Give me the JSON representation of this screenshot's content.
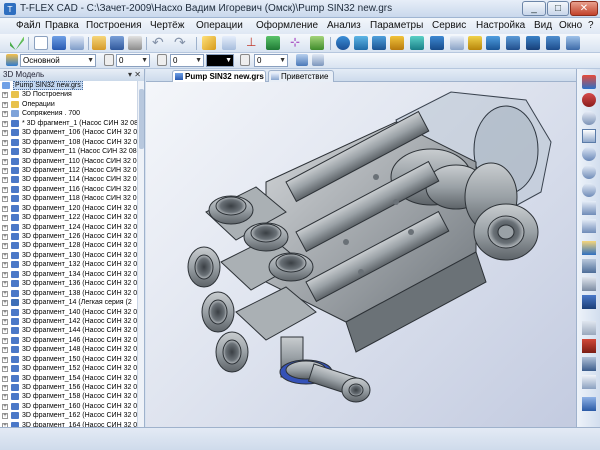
{
  "window": {
    "title": "T-FLEX CAD - C:\\Зачет-2009\\Насхо Вадим Игоревич (Омск)\\Pump SIN32 new.grs",
    "minimize": "_",
    "maximize": "□",
    "close": "✕"
  },
  "menu": [
    "Файл",
    "Правка",
    "Построения",
    "Чертёж",
    "Операции",
    "Оформление",
    "Анализ",
    "Параметры",
    "Сервис",
    "Настройка",
    "Вид",
    "Окно",
    "?"
  ],
  "toolbar2": {
    "layer_combo": "Основной",
    "value1": "0",
    "value2": "0",
    "value3": "0"
  },
  "left_panel": {
    "title": "3D Модель",
    "buttons": "▾ ✕",
    "tree": [
      {
        "label": "Pump SIN32 new.grs",
        "type": "root",
        "selected": true
      },
      {
        "label": "3D Построения",
        "type": "folder"
      },
      {
        "label": "Операции",
        "type": "folder"
      },
      {
        "label": "Сопряжения . 700",
        "type": "mate"
      },
      {
        "label": "* 3D фрагмент_1 (Насос СИН 32 08",
        "type": "frag"
      },
      {
        "label": "3D фрагмент_106 (Насос СИН 32 0",
        "type": "frag"
      },
      {
        "label": "3D фрагмент_108 (Насос СИН 32 0",
        "type": "frag"
      },
      {
        "label": "3D фрагмент_11 (Насос СИН 32 08",
        "type": "frag"
      },
      {
        "label": "3D фрагмент_110 (Насос СИН 32 0",
        "type": "frag"
      },
      {
        "label": "3D фрагмент_112 (Насос СИН 32 0",
        "type": "frag"
      },
      {
        "label": "3D фрагмент_114 (Насос СИН 32 0",
        "type": "frag"
      },
      {
        "label": "3D фрагмент_116 (Насос СИН 32 0",
        "type": "frag"
      },
      {
        "label": "3D фрагмент_118 (Насос СИН 32 0",
        "type": "frag"
      },
      {
        "label": "3D фрагмент_120 (Насос СИН 32 0",
        "type": "frag"
      },
      {
        "label": "3D фрагмент_122 (Насос СИН 32 0",
        "type": "frag"
      },
      {
        "label": "3D фрагмент_124 (Насос СИН 32 0",
        "type": "frag"
      },
      {
        "label": "3D фрагмент_126 (Насос СИН 32 0",
        "type": "frag"
      },
      {
        "label": "3D фрагмент_128 (Насос СИН 32 0",
        "type": "frag"
      },
      {
        "label": "3D фрагмент_130 (Насос СИН 32 0",
        "type": "frag"
      },
      {
        "label": "3D фрагмент_132 (Насос СИН 32 0",
        "type": "frag"
      },
      {
        "label": "3D фрагмент_134 (Насос СИН 32 0",
        "type": "frag"
      },
      {
        "label": "3D фрагмент_136 (Насос СИН 32 0",
        "type": "frag"
      },
      {
        "label": "3D фрагмент_138 (Насос СИН 32 0",
        "type": "frag"
      },
      {
        "label": "3D фрагмент_14 (Легкая серия (2",
        "type": "frag2"
      },
      {
        "label": "3D фрагмент_140 (Насос СИН 32 0",
        "type": "frag"
      },
      {
        "label": "3D фрагмент_142 (Насос СИН 32 0",
        "type": "frag"
      },
      {
        "label": "3D фрагмент_144 (Насос СИН 32 0",
        "type": "frag"
      },
      {
        "label": "3D фрагмент_146 (Насос СИН 32 0",
        "type": "frag"
      },
      {
        "label": "3D фрагмент_148 (Насос СИН 32 0",
        "type": "frag"
      },
      {
        "label": "3D фрагмент_150 (Насос СИН 32 0",
        "type": "frag"
      },
      {
        "label": "3D фрагмент_152 (Насос СИН 32 0",
        "type": "frag"
      },
      {
        "label": "3D фрагмент_154 (Насос СИН 32 0",
        "type": "frag"
      },
      {
        "label": "3D фрагмент_156 (Насос СИН 32 0",
        "type": "frag"
      },
      {
        "label": "3D фрагмент_158 (Насос СИН 32 0",
        "type": "frag"
      },
      {
        "label": "3D фрагмент_160 (Насос СИН 32 0",
        "type": "frag"
      },
      {
        "label": "3D фрагмент_162 (Насос СИН 32 0",
        "type": "frag"
      },
      {
        "label": "3D фрагмент_164 (Насос СИН 32 0",
        "type": "frag"
      }
    ]
  },
  "tabs": [
    {
      "label": "Pump SIN32 new.grs",
      "active": true
    },
    {
      "label": "Приветствие",
      "active": false
    }
  ],
  "colors": {
    "accent": "#3a6ea5",
    "folder": "#e8c14a",
    "fragment": "#4a78c8",
    "model_grey": "#8c9296"
  }
}
